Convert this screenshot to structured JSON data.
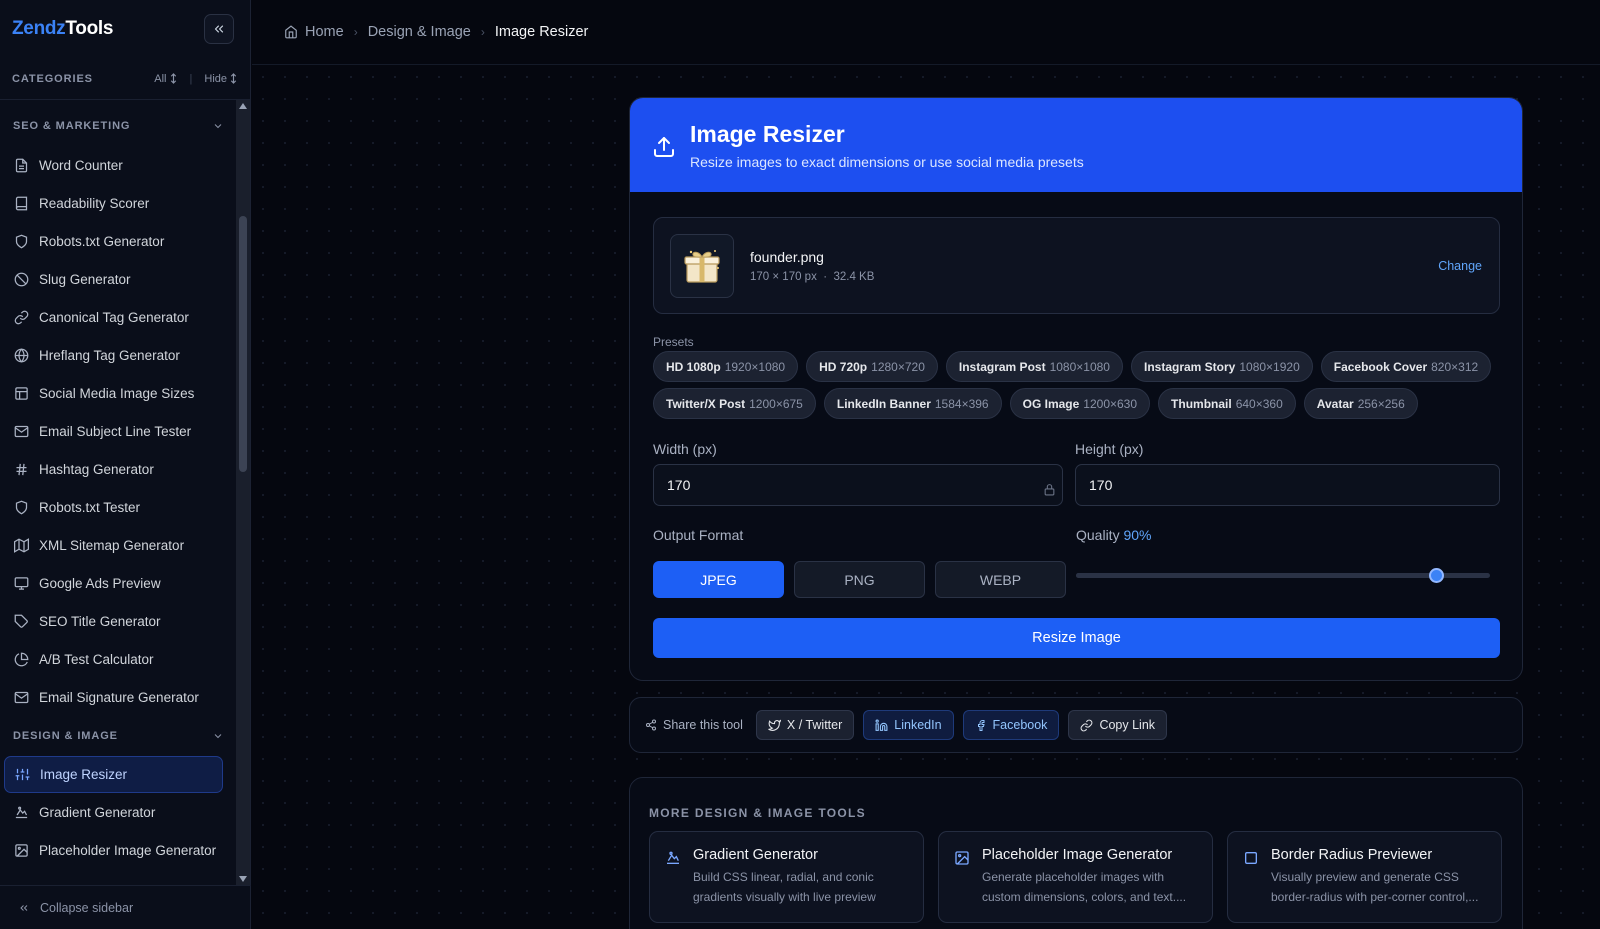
{
  "sidebar": {
    "logo_part1": "Zendz",
    "logo_part2": "Tools",
    "categories_label": "CATEGORIES",
    "all_label": "All",
    "hide_label": "Hide",
    "sections": [
      {
        "title": "SEO & MARKETING",
        "items": [
          {
            "label": "Word Counter",
            "icon": "document-icon"
          },
          {
            "label": "Readability Scorer",
            "icon": "book-icon"
          },
          {
            "label": "Robots.txt Generator",
            "icon": "shield-icon"
          },
          {
            "label": "Slug Generator",
            "icon": "ban-icon"
          },
          {
            "label": "Canonical Tag Generator",
            "icon": "link-icon"
          },
          {
            "label": "Hreflang Tag Generator",
            "icon": "globe-icon"
          },
          {
            "label": "Social Media Image Sizes",
            "icon": "layout-icon"
          },
          {
            "label": "Email Subject Line Tester",
            "icon": "mail-icon"
          },
          {
            "label": "Hashtag Generator",
            "icon": "hash-icon"
          },
          {
            "label": "Robots.txt Tester",
            "icon": "shield-icon"
          },
          {
            "label": "XML Sitemap Generator",
            "icon": "map-icon"
          },
          {
            "label": "Google Ads Preview",
            "icon": "monitor-icon"
          },
          {
            "label": "SEO Title Generator",
            "icon": "tag-icon"
          },
          {
            "label": "A/B Test Calculator",
            "icon": "pie-icon"
          },
          {
            "label": "Email Signature Generator",
            "icon": "mail-icon"
          }
        ]
      },
      {
        "title": "DESIGN & IMAGE",
        "items": [
          {
            "label": "Image Resizer",
            "icon": "sliders-icon"
          },
          {
            "label": "Gradient Generator",
            "icon": "gradient-icon"
          },
          {
            "label": "Placeholder Image Generator",
            "icon": "image-icon"
          }
        ]
      }
    ],
    "collapse_label": "Collapse sidebar"
  },
  "breadcrumb": {
    "home": "Home",
    "category": "Design & Image",
    "current": "Image Resizer"
  },
  "tool": {
    "title": "Image Resizer",
    "subtitle": "Resize images to exact dimensions or use social media presets",
    "file": {
      "name": "founder.png",
      "dimensions": "170 × 170 px",
      "separator": "·",
      "size": "32.4 KB",
      "change_label": "Change"
    },
    "presets_label": "Presets",
    "presets_row1": [
      {
        "name": "HD 1080p",
        "dims": "1920×1080"
      },
      {
        "name": "HD 720p",
        "dims": "1280×720"
      },
      {
        "name": "Instagram Post",
        "dims": "1080×1080"
      },
      {
        "name": "Instagram Story",
        "dims": "1080×1920"
      },
      {
        "name": "Facebook Cover",
        "dims": "820×312"
      }
    ],
    "presets_row2": [
      {
        "name": "Twitter/X Post",
        "dims": "1200×675"
      },
      {
        "name": "LinkedIn Banner",
        "dims": "1584×396"
      },
      {
        "name": "OG Image",
        "dims": "1200×630"
      },
      {
        "name": "Thumbnail",
        "dims": "640×360"
      },
      {
        "name": "Avatar",
        "dims": "256×256"
      }
    ],
    "width_label": "Width (px)",
    "width_value": "170",
    "height_label": "Height (px)",
    "height_value": "170",
    "format_label": "Output Format",
    "formats": [
      "JPEG",
      "PNG",
      "WEBP"
    ],
    "selected_format": "JPEG",
    "quality_label": "Quality",
    "quality_value": "90%",
    "quality_fraction": 0.87,
    "resize_button": "Resize Image"
  },
  "share": {
    "label": "Share this tool",
    "buttons": [
      "X / Twitter",
      "LinkedIn",
      "Facebook",
      "Copy Link"
    ]
  },
  "more": {
    "title": "MORE DESIGN & IMAGE TOOLS",
    "tools": [
      {
        "name": "Gradient Generator",
        "desc": "Build CSS linear, radial, and conic gradients visually with live preview and...",
        "icon": "gradient-icon"
      },
      {
        "name": "Placeholder Image Generator",
        "desc": "Generate placeholder images with custom dimensions, colors, and text....",
        "icon": "image-icon"
      },
      {
        "name": "Border Radius Previewer",
        "desc": "Visually preview and generate CSS border-radius with per-corner control,...",
        "icon": "square-icon"
      }
    ]
  },
  "colors": {
    "accent": "#1d5ff5",
    "header_blue": "#1d4ff0",
    "background": "#05070f",
    "link": "#60a5fa"
  }
}
